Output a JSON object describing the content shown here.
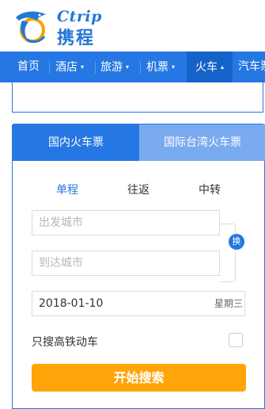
{
  "brand": {
    "name_en": "Ctrip",
    "name_cn": "携程"
  },
  "nav": {
    "items": [
      {
        "label": "首页",
        "has_caret": false
      },
      {
        "label": "酒店",
        "has_caret": true
      },
      {
        "label": "旅游",
        "has_caret": true
      },
      {
        "label": "机票",
        "has_caret": true
      },
      {
        "label": "火车",
        "has_caret": true,
        "active": true
      },
      {
        "label": "汽车票",
        "has_caret": false
      }
    ],
    "caret": "▾",
    "caret_active": "▴"
  },
  "tabs": {
    "domestic": "国内火车票",
    "international": "国际台湾火车票"
  },
  "trip_types": {
    "one_way": "单程",
    "round_trip": "往返",
    "transfer": "中转"
  },
  "form": {
    "departure_placeholder": "出发城市",
    "arrival_placeholder": "到达城市",
    "swap_label": "换",
    "date": "2018-01-10",
    "weekday": "星期三",
    "high_speed_label": "只搜高铁动车",
    "high_speed_checked": false,
    "search_button": "开始搜索"
  },
  "colors": {
    "primary": "#2577e3",
    "tab_inactive": "#7aaaf0",
    "search_button": "#ffa50a"
  }
}
